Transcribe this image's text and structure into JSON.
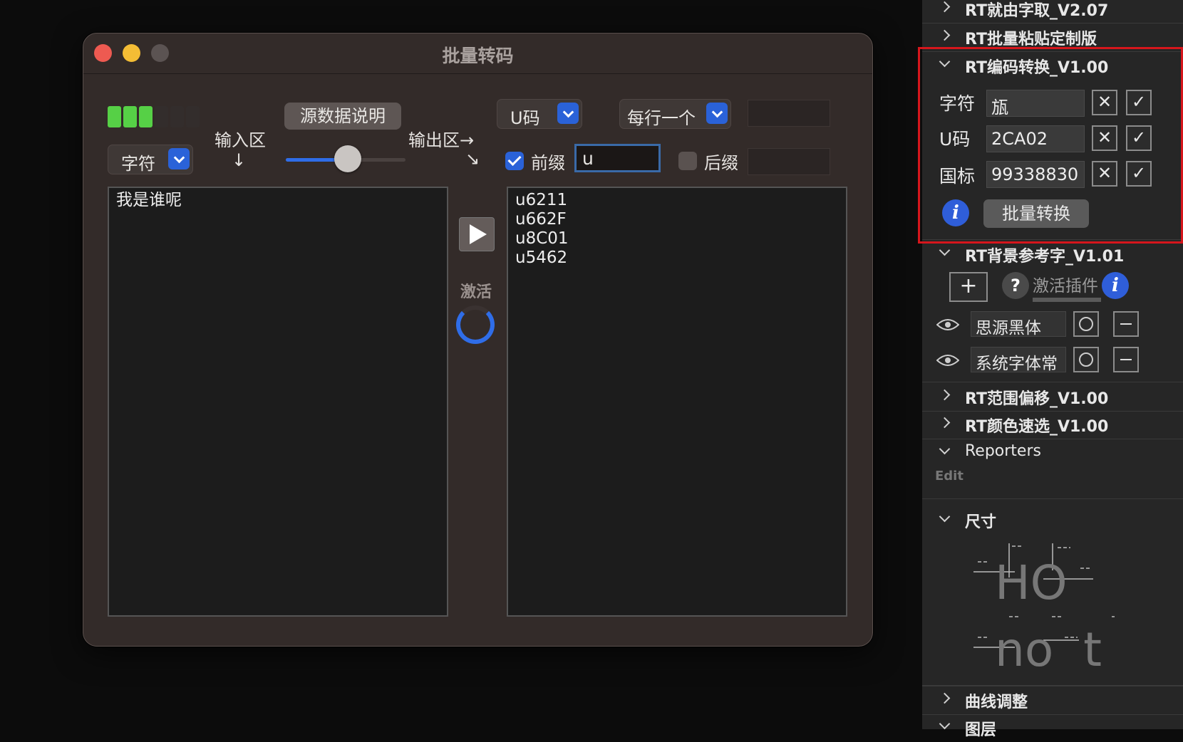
{
  "dialog": {
    "title": "批量转码",
    "source_help_button": "源数据说明",
    "input_label": "输入区",
    "input_arrow": "↓",
    "output_label": "输出区→",
    "output_arrow": "↘",
    "input_type_popup": "字符",
    "output_code_popup": "U码",
    "per_line_popup": "每行一个",
    "prefix_label": "前缀",
    "prefix_checked": true,
    "prefix_value": "u",
    "suffix_label": "后缀",
    "suffix_checked": false,
    "suffix_value": "",
    "separator_value": "",
    "slider_value_fraction": 0.52,
    "meter_level": 3,
    "meter_total": 6,
    "input_text": "我是谁呢",
    "output_lines": [
      "u6211",
      "u662F",
      "u8C01",
      "u5462"
    ],
    "activate_label": "激活"
  },
  "panel": {
    "top_sections": [
      "RT就由字取_V2.07",
      "RT批量粘贴定制版"
    ],
    "encode_section": {
      "title": "RT编码转换_V1.00",
      "rows": [
        {
          "label": "字符",
          "value": "瓬"
        },
        {
          "label": "U码",
          "value": "2CA02"
        },
        {
          "label": "国标",
          "value": "99338830"
        }
      ],
      "convert_button": "批量转换",
      "info_icon": "i"
    },
    "bg_section": {
      "title": "RT背景参考字_V1.01",
      "add_label": "+",
      "help_label": "?",
      "activate_plugin": "激活插件",
      "info_icon": "i",
      "fonts": [
        "思源黑体",
        "系统字体常"
      ]
    },
    "sections_after": [
      "RT范围偏移_V1.00",
      "RT颜色速选_V1.00"
    ],
    "reporters": {
      "title": "Reporters",
      "edit": "Edit"
    },
    "size_section": {
      "title": "尺寸",
      "sample_top": "HO",
      "sample_bottom": "no  t"
    },
    "curve_section": "曲线调整",
    "layers_section": "图层"
  },
  "colors": {
    "accent_blue": "#2a62d8",
    "meter_green": "#56d046",
    "highlight_red": "#d6161c"
  },
  "icons": [
    "chevron-right-icon",
    "chevron-down-icon",
    "close-icon",
    "check-icon",
    "info-icon",
    "eye-icon",
    "ellipsis-icon",
    "minus-icon",
    "plus-icon",
    "play-icon"
  ]
}
